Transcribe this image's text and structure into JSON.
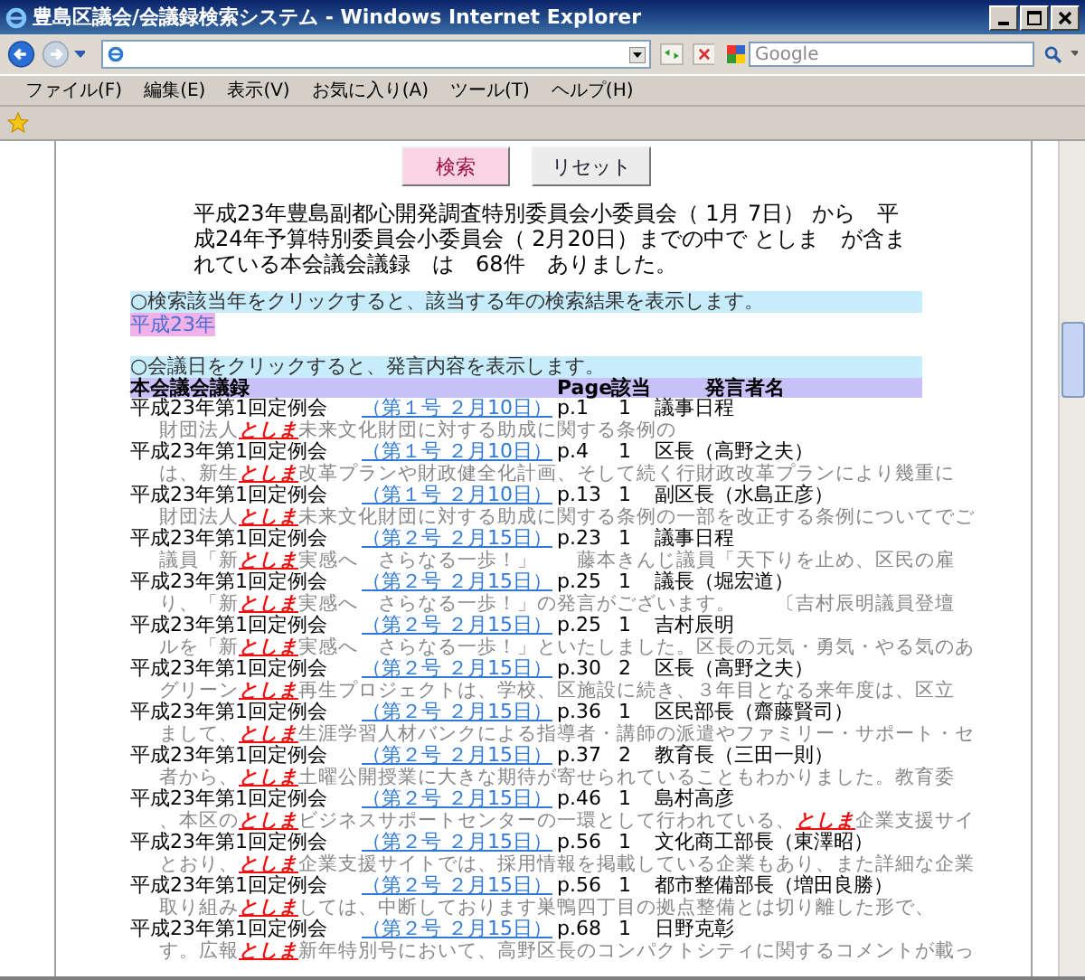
{
  "window": {
    "title": "豊島区議会/会議録検索システム - Windows Internet Explorer"
  },
  "search": {
    "placeholder": "Google"
  },
  "menu": [
    "ファイル(F)",
    "編集(E)",
    "表示(V)",
    "お気に入り(A)",
    "ツール(T)",
    "ヘルプ(H)"
  ],
  "buttons": [
    {
      "label": "検索",
      "kind": "primary"
    },
    {
      "label": "リセット",
      "kind": "secondary"
    }
  ],
  "summary": "平成23年豊島副都心開発調査特別委員会小委員会（ 1月 7日） から　平成24年予算特別委員会小委員会（ 2月20日）までの中で としま　が含まれている本会議会議録　は　68件　ありました。",
  "year_notice": "○検索該当年をクリックすると、該当する年の検索結果を表示します。",
  "years": [
    {
      "label": "平成23年",
      "selected": true
    }
  ],
  "result_notice": "○会議日をクリックすると、発言内容を表示します。",
  "table": {
    "columns": [
      "本会議会議録",
      "Page",
      "該当",
      "発言者名"
    ],
    "rows": [
      {
        "session": "平成23年第1回定例会",
        "date": "（第１号 ２月10日）",
        "page": "p.1",
        "hits": "1",
        "speaker": "議事日程",
        "snippet": "財団法人**としま**未来文化財団に対する助成に関する条例の"
      },
      {
        "session": "平成23年第1回定例会",
        "date": "（第１号 ２月10日）",
        "page": "p.4",
        "hits": "1",
        "speaker": "区長（高野之夫）",
        "snippet": "は、新生**としま**改革プランや財政健全化計画、そして続く行財政改革プランにより幾重に"
      },
      {
        "session": "平成23年第1回定例会",
        "date": "（第１号 ２月10日）",
        "page": "p.13",
        "hits": "1",
        "speaker": "副区長（水島正彦）",
        "snippet": "財団法人**としま**未来文化財団に対する助成に関する条例の一部を改正する条例についてでご"
      },
      {
        "session": "平成23年第1回定例会",
        "date": "（第２号 ２月15日）",
        "page": "p.23",
        "hits": "1",
        "speaker": "議事日程",
        "snippet": "議員「新**としま**実感へ　さらなる一歩！」　　藤本きんじ議員「天下りを止め、区民の雇"
      },
      {
        "session": "平成23年第1回定例会",
        "date": "（第２号 ２月15日）",
        "page": "p.25",
        "hits": "1",
        "speaker": "議長（堀宏道）",
        "snippet": "り、「新**としま**実感へ　さらなる一歩！」の発言がございます。　　〔吉村辰明議員登壇"
      },
      {
        "session": "平成23年第1回定例会",
        "date": "（第２号 ２月15日）",
        "page": "p.25",
        "hits": "1",
        "speaker": "吉村辰明",
        "snippet": "ルを「新**としま**実感へ　さらなる一歩！」といたしました。区長の元気・勇気・やる気のあ"
      },
      {
        "session": "平成23年第1回定例会",
        "date": "（第２号 ２月15日）",
        "page": "p.30",
        "hits": "2",
        "speaker": "区長（高野之夫）",
        "snippet": "グリーン**としま**再生プロジェクトは、学校、区施設に続き、３年目となる来年度は、区立"
      },
      {
        "session": "平成23年第1回定例会",
        "date": "（第２号 ２月15日）",
        "page": "p.36",
        "hits": "1",
        "speaker": "区民部長（齋藤賢司）",
        "snippet": "まして、**としま**生涯学習人材バンクによる指導者・講師の派遣やファミリー・サポート・セ"
      },
      {
        "session": "平成23年第1回定例会",
        "date": "（第２号 ２月15日）",
        "page": "p.37",
        "hits": "2",
        "speaker": "教育長（三田一則）",
        "snippet": "者から、**としま**土曜公開授業に大きな期待が寄せられていることもわかりました。教育委"
      },
      {
        "session": "平成23年第1回定例会",
        "date": "（第２号 ２月15日）",
        "page": "p.46",
        "hits": "1",
        "speaker": "島村高彦",
        "snippet": "、本区の**としま**ビジネスサポートセンターの一環として行われている、**としま**企業支援サイ"
      },
      {
        "session": "平成23年第1回定例会",
        "date": "（第２号 ２月15日）",
        "page": "p.56",
        "hits": "1",
        "speaker": "文化商工部長（東澤昭）",
        "snippet": "とおり、**としま**企業支援サイトでは、採用情報を掲載している企業もあり、また詳細な企業"
      },
      {
        "session": "平成23年第1回定例会",
        "date": "（第２号 ２月15日）",
        "page": "p.56",
        "hits": "1",
        "speaker": "都市整備部長（増田良勝）",
        "snippet": "取り組み**としま**しては、中断しております巣鴨四丁目の拠点整備とは切り離した形で、"
      },
      {
        "session": "平成23年第1回定例会",
        "date": "（第２号 ２月15日）",
        "page": "p.68",
        "hits": "1",
        "speaker": "日野克彰",
        "snippet": "す。広報**としま**新年特別号において、高野区長のコンパクトシティに関するコメントが載っ"
      }
    ]
  }
}
